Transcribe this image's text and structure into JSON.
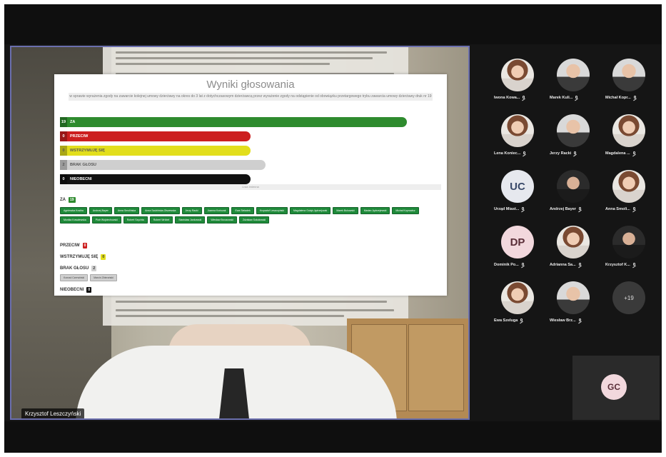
{
  "main_video": {
    "speaker_name": "Krzysztof Leszczyński"
  },
  "voting": {
    "title": "Wyniki głosowania",
    "description": "w sprawie wyrażenia zgody na zawarcie kolejnej umowy dzierżawy na okres do 3 lat z dotychczasowym dzierżawcą przez wyrażenie zgody na odstąpienie od obowiązku przetargowego trybu zawarcia umowy dzierżawy druk nr 19",
    "bars": [
      {
        "label": "ZA",
        "count": "19",
        "fraction": 0.91,
        "color": "#2e8b2e"
      },
      {
        "label": "PRZECIW",
        "count": "0",
        "fraction": 0.5,
        "color": "#cc1f1f"
      },
      {
        "label": "WSTRZYMUJĘ SIĘ",
        "count": "0",
        "fraction": 0.5,
        "color": "#e2de1c"
      },
      {
        "label": "BRAK GŁOSU",
        "count": "2",
        "fraction": 0.54,
        "color": "#cfcfcf"
      },
      {
        "label": "NIEOBECNI",
        "count": "0",
        "fraction": 0.5,
        "color": "#111111"
      }
    ],
    "separator_text": "Lista imienna",
    "sections": {
      "za": {
        "label": "ZA",
        "count": "19"
      },
      "przeciw": {
        "label": "PRZECIW",
        "count": "0"
      },
      "wstrzymuje": {
        "label": "WSTRZYMUJĘ SIĘ",
        "count": "0"
      },
      "brak": {
        "label": "BRAK GŁOSU",
        "count": "2"
      },
      "nieobecni": {
        "label": "NIEOBECNI",
        "count": "0"
      }
    },
    "za_names": [
      "Agnieszka Kosiba",
      "Andrzej Bayer",
      "Anna Smolińska",
      "Anna Szubińska-Olszewska",
      "Jerzy Racki",
      "Joanna Kończak",
      "Ewa Sieładek",
      "Krzysztof Leszczyński",
      "Magdalena Gołąb-Jędrzejczak",
      "Marek Bukowski",
      "Marian Jędrzejewski",
      "Michał Koprowicz",
      "Monika Kowalewska",
      "Piotr Wojciechowski",
      "Robert Szychta",
      "Robert Wróbel",
      "Stanisław Jankowski",
      "Wiesław Brzozowski",
      "Zdzisław Sokołowski"
    ],
    "brak_names": [
      "Konrad Czerwiński",
      "Marcin Zbierański"
    ]
  },
  "participants": [
    {
      "name": "Iwona Kowa...",
      "avatar": "photo-w"
    },
    {
      "name": "Marek Kuli...",
      "avatar": "photo"
    },
    {
      "name": "Michał Kopr...",
      "avatar": "photo"
    },
    {
      "name": "Lena Koniec...",
      "avatar": "photo-w"
    },
    {
      "name": "Jerzy Racki",
      "avatar": "photo"
    },
    {
      "name": "Magdalena ...",
      "avatar": "photo-w"
    },
    {
      "name": "Urząd Miast...",
      "avatar": "UC"
    },
    {
      "name": "Andrzej Bayer",
      "avatar": "photo-dk"
    },
    {
      "name": "Anna Smoli...",
      "avatar": "photo-w"
    },
    {
      "name": "Dominik Po...",
      "avatar": "DP"
    },
    {
      "name": "Adrianna Sa...",
      "avatar": "photo-w"
    },
    {
      "name": "Krzysztof K...",
      "avatar": "photo-dk"
    },
    {
      "name": "Ewa Szeluga",
      "avatar": "photo-w"
    },
    {
      "name": "Wiesław Brz...",
      "avatar": "photo"
    },
    {
      "name": "",
      "avatar": "+19"
    }
  ],
  "extra_tile": {
    "initials": "GC"
  }
}
